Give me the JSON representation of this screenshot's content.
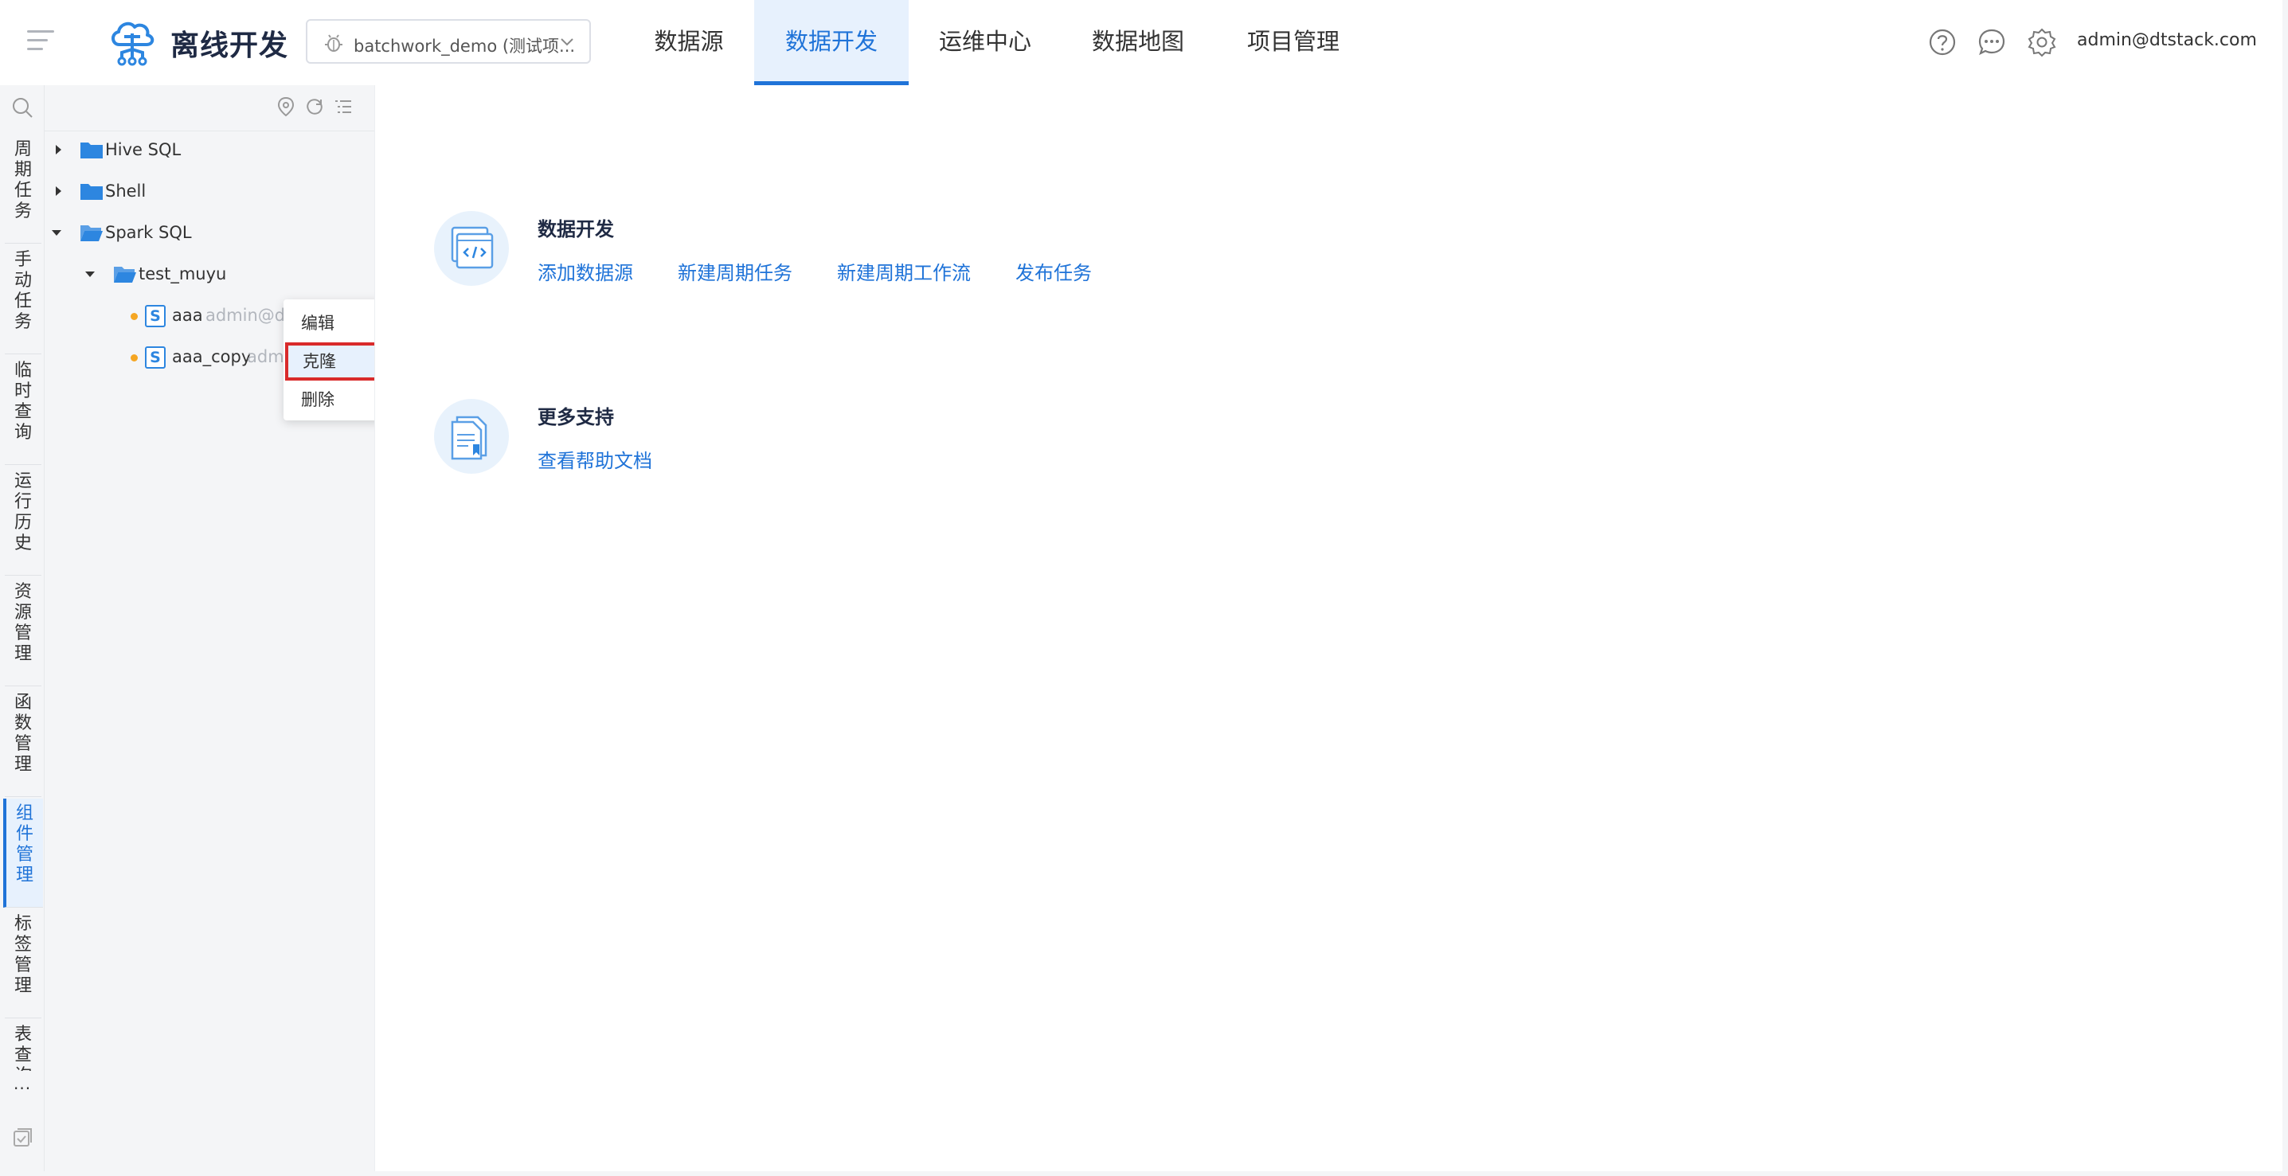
{
  "header": {
    "app_title": "离线开发",
    "project_select": "batchwork_demo (测试项...",
    "nav_tabs": [
      "数据源",
      "数据开发",
      "运维中心",
      "数据地图",
      "项目管理"
    ],
    "active_tab": "数据开发",
    "user_email": "admin@dtstack.com",
    "icons": [
      "help-icon",
      "message-icon",
      "settings-icon"
    ],
    "accent_color": "#1f73d8"
  },
  "rail": {
    "items": [
      {
        "label": "周期任务",
        "chars": [
          "周",
          "期",
          "任",
          "务"
        ]
      },
      {
        "label": "手动任务",
        "chars": [
          "手",
          "动",
          "任",
          "务"
        ]
      },
      {
        "label": "临时查询",
        "chars": [
          "临",
          "时",
          "查",
          "询"
        ]
      },
      {
        "label": "运行历史",
        "chars": [
          "运",
          "行",
          "历",
          "史"
        ]
      },
      {
        "label": "资源管理",
        "chars": [
          "资",
          "源",
          "管",
          "理"
        ]
      },
      {
        "label": "函数管理",
        "chars": [
          "函",
          "数",
          "管",
          "理"
        ]
      },
      {
        "label": "组件管理",
        "chars": [
          "组",
          "件",
          "管",
          "理"
        ]
      },
      {
        "label": "标签管理",
        "chars": [
          "标",
          "签",
          "管",
          "理"
        ]
      },
      {
        "label": "表查询",
        "chars": [
          "表",
          "查",
          "询"
        ]
      }
    ],
    "active_item": "组件管理",
    "more": "···"
  },
  "tree": {
    "folders": [
      {
        "name": "Hive SQL",
        "expanded": false
      },
      {
        "name": "Shell",
        "expanded": false
      },
      {
        "name": "Spark SQL",
        "expanded": true
      }
    ],
    "subfolder": {
      "name": "test_muyu",
      "expanded": true
    },
    "files": [
      {
        "name": "aaa",
        "owner": "admin@dts",
        "badge": "S"
      },
      {
        "name": "aaa_copy",
        "owner": "adm",
        "badge": "S"
      }
    ]
  },
  "context_menu": {
    "items": [
      "编辑",
      "克隆",
      "删除"
    ],
    "highlighted": "克隆"
  },
  "main": {
    "dev": {
      "title": "数据开发",
      "links": [
        "添加数据源",
        "新建周期任务",
        "新建周期工作流",
        "发布任务"
      ]
    },
    "support": {
      "title": "更多支持",
      "links": [
        "查看帮助文档"
      ]
    }
  }
}
